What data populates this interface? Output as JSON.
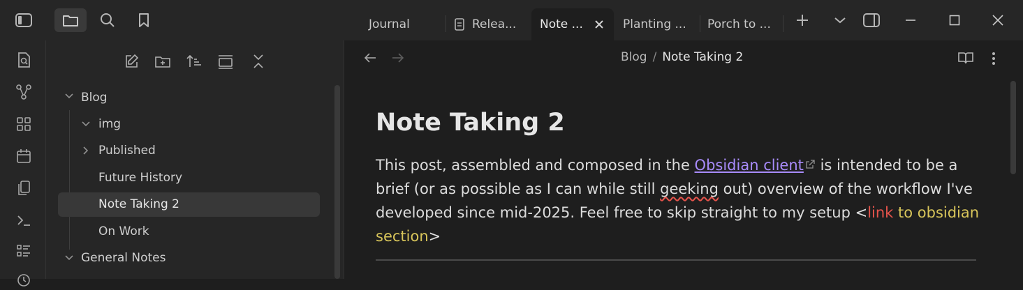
{
  "tabs": [
    {
      "label": "Journal"
    },
    {
      "label": "Relea..."
    },
    {
      "label": "Note ...",
      "active": true
    },
    {
      "label": "Planting ..."
    },
    {
      "label": "Porch to ..."
    }
  ],
  "top_icons": [
    "sidebar-toggle-icon",
    "folder-icon",
    "search-icon",
    "bookmark-icon"
  ],
  "window_controls": [
    "new-tab-icon",
    "tab-list-icon",
    "right-sidebar-icon",
    "minimize-icon",
    "maximize-icon",
    "close-window-icon"
  ],
  "ribbon_icons": [
    "quick-switch-icon",
    "graph-view-icon",
    "canvas-icon",
    "daily-note-icon",
    "templates-icon",
    "command-palette-icon",
    "outline-icon",
    "history-icon"
  ],
  "explorer": {
    "toolbar": [
      "new-note-icon",
      "new-folder-icon",
      "sort-icon",
      "collapse-all-icon",
      "expand-icon"
    ],
    "tree": {
      "blog": "Blog",
      "img": "img",
      "published": "Published",
      "future_history": "Future History",
      "note_taking_2": "Note Taking 2",
      "on_work": "On Work",
      "general_notes": "General Notes"
    }
  },
  "breadcrumb": {
    "parent": "Blog",
    "separator": "/",
    "current": "Note Taking 2"
  },
  "note": {
    "title": "Note Taking 2",
    "p1": "This post, assembled and composed in the ",
    "link": "Obsidian client",
    "p2": " is intended to be a brief (or as possible as I can while still ",
    "squiggly": "geeking",
    "p3": " out) overview of the workflow I've developed since mid-2025. Feel free to skip straight to my setup <",
    "red_text": "link",
    "yellow_text": " to obsidian section",
    "p4": ">"
  },
  "colors": {
    "accent_link": "#a88bfa",
    "red": "#e5534b",
    "yellow": "#d8c55a"
  }
}
